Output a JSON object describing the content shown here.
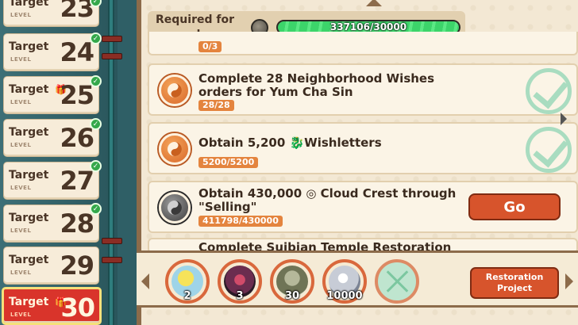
{
  "levels": [
    {
      "label": "Target",
      "sub": "LEVEL",
      "num": "23",
      "done": true
    },
    {
      "label": "Target",
      "sub": "LEVEL",
      "num": "24",
      "done": true
    },
    {
      "label": "Target",
      "sub": "LEVEL",
      "num": "25",
      "done": true
    },
    {
      "label": "Target",
      "sub": "LEVEL",
      "num": "26",
      "done": true
    },
    {
      "label": "Target",
      "sub": "LEVEL",
      "num": "27",
      "done": true
    },
    {
      "label": "Target",
      "sub": "LEVEL",
      "num": "28",
      "done": true
    },
    {
      "label": "Target",
      "sub": "LEVEL",
      "num": "29",
      "done": false
    },
    {
      "label": "Target",
      "sub": "LEVEL",
      "num": "30",
      "done": false,
      "active": true
    }
  ],
  "requirement": {
    "label": "Required for upgrade:",
    "progress_text": "337106/30000",
    "progress_fraction": 1.0
  },
  "tasks": [
    {
      "title": "",
      "count": "0/3",
      "done": true
    },
    {
      "title": "Complete 28 Neighborhood Wishes orders for Yum Cha Sin",
      "count": "28/28",
      "done": true,
      "icon": "yin-yang-icon"
    },
    {
      "title": "Obtain 5,200 🐉Wishletters",
      "count": "5200/5200",
      "done": true,
      "icon": "yin-yang-icon"
    },
    {
      "title": "Obtain 430,000 ◎ Cloud Crest through \"Selling\"",
      "count": "411798/430000",
      "done": false,
      "icon": "yin-yang-grey-icon",
      "button": "Go"
    },
    {
      "title": "Complete Suibian Temple Restoration",
      "count": "",
      "done": false
    }
  ],
  "rewards": [
    {
      "name": "ticket-reward-icon",
      "qty": "2",
      "color": "#9fd4e8"
    },
    {
      "name": "scroll-reward-icon",
      "qty": "3",
      "color": "#6b2d4f"
    },
    {
      "name": "lantern-reward-icon",
      "qty": "30",
      "color": "#8a8f6a"
    },
    {
      "name": "silver-coin-reward-icon",
      "qty": "10000",
      "color": "#c7ccd6"
    }
  ],
  "restoration_button": "Restoration Project",
  "colors": {
    "accent": "#d7542c",
    "progress": "#3cd46a",
    "active_level": "#d9342b"
  }
}
